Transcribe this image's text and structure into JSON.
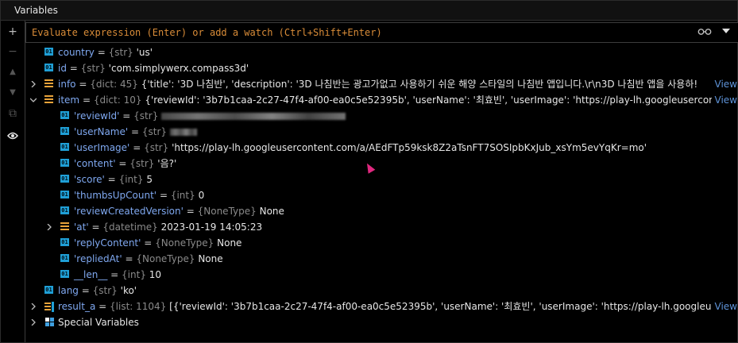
{
  "panel": {
    "title": "Variables"
  },
  "eval": {
    "placeholder": "Evaluate expression (Enter) or add a watch (Ctrl+Shift+Enter)"
  },
  "toolbar": {
    "add": "+",
    "remove": "−",
    "up": "▲",
    "down": "▼",
    "copy": "⧉",
    "view": "👁"
  },
  "rows": [
    {
      "name": "country",
      "type": "{str}",
      "value": "'us'"
    },
    {
      "name": "id",
      "type": "{str}",
      "value": "'com.simplywerx.compass3d'"
    },
    {
      "name": "info",
      "type": "{dict: 45}",
      "value": "{'title': '3D 나침반', 'description': '3D 나침반는 광고가없고 사용하기 쉬운 해양 스타일의 나침반 앱입니다.\\r\\n3D 나침반 앱을 사용하!",
      "link": "View"
    },
    {
      "name": "item",
      "type": "{dict: 10}",
      "value": "{'reviewId': '3b7b1caa-2c27-47f4-af00-ea0c5e52395b', 'userName': '최효빈', 'userImage': 'https://play-lh.googleusercontent.com/a/A",
      "link": "View"
    },
    {
      "name": "'reviewId'",
      "type": "{str}",
      "value": ""
    },
    {
      "name": "'userName'",
      "type": "{str}",
      "value": ""
    },
    {
      "name": "'userImage'",
      "type": "{str}",
      "value": "'https://play-lh.googleusercontent.com/a/AEdFTp59ksk8Z2aTsnFT7SOSIpbKxJub_xsYm5evYqKr=mo'"
    },
    {
      "name": "'content'",
      "type": "{str}",
      "value": "'음?'"
    },
    {
      "name": "'score'",
      "type": "{int}",
      "value": "5"
    },
    {
      "name": "'thumbsUpCount'",
      "type": "{int}",
      "value": "0"
    },
    {
      "name": "'reviewCreatedVersion'",
      "type": "{NoneType}",
      "value": "None"
    },
    {
      "name": "'at'",
      "type": "{datetime}",
      "value": "2023-01-19 14:05:23"
    },
    {
      "name": "'replyContent'",
      "type": "{NoneType}",
      "value": "None"
    },
    {
      "name": "'repliedAt'",
      "type": "{NoneType}",
      "value": "None"
    },
    {
      "name": "__len__",
      "type": "{int}",
      "value": "10"
    },
    {
      "name": "lang",
      "type": "{str}",
      "value": "'ko'"
    },
    {
      "name": "result_a",
      "type": "{list: 1104}",
      "value": "[{'reviewId': '3b7b1caa-2c27-47f4-af00-ea0c5e52395b', 'userName': '최효빈', 'userImage': 'https://play-lh.googleusercontent.com",
      "link": "View"
    },
    {
      "name": "Special Variables"
    }
  ],
  "colors": {
    "accent": "#d98c38",
    "name": "#7fa8f0",
    "type": "#8a8a8a",
    "link": "#5e93d8"
  }
}
